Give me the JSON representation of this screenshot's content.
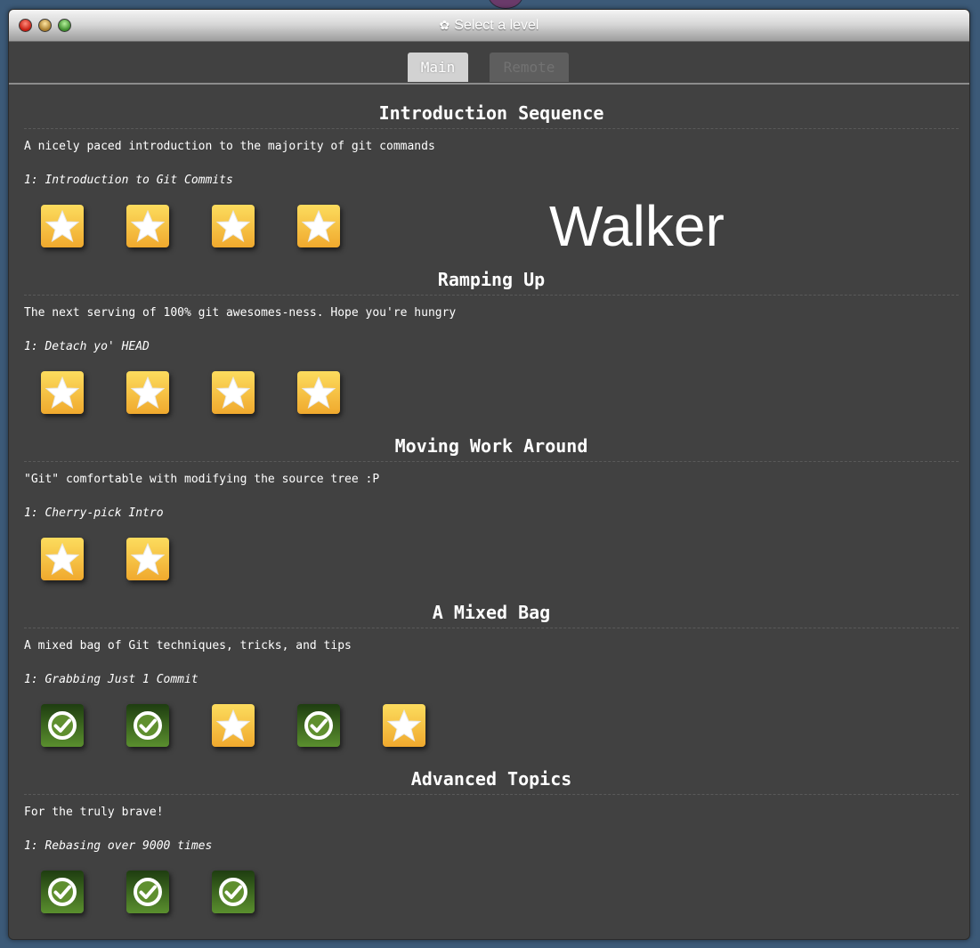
{
  "window": {
    "title": "Select a level"
  },
  "tabs": [
    {
      "label": "Main",
      "selected": true
    },
    {
      "label": "Remote",
      "selected": false
    }
  ],
  "overlay_text": "Walker",
  "sequences": [
    {
      "title": "Introduction Sequence",
      "description": "A nicely paced introduction to the majority of git commands",
      "level_name": "1: Introduction to Git Commits",
      "levels": [
        "star",
        "star",
        "star",
        "star"
      ]
    },
    {
      "title": "Ramping Up",
      "description": "The next serving of 100% git awesomes-ness. Hope you're hungry",
      "level_name": "1: Detach yo' HEAD",
      "levels": [
        "star",
        "star",
        "star",
        "star"
      ]
    },
    {
      "title": "Moving Work Around",
      "description": "\"Git\" comfortable with modifying the source tree :P",
      "level_name": "1: Cherry-pick Intro",
      "levels": [
        "star",
        "star"
      ]
    },
    {
      "title": "A Mixed Bag",
      "description": "A mixed bag of Git techniques, tricks, and tips",
      "level_name": "1: Grabbing Just 1 Commit",
      "levels": [
        "check",
        "check",
        "star",
        "check",
        "star"
      ]
    },
    {
      "title": "Advanced Topics",
      "description": "For the truly brave!",
      "level_name": "1: Rebasing over 9000 times",
      "levels": [
        "check",
        "check",
        "check"
      ]
    }
  ]
}
